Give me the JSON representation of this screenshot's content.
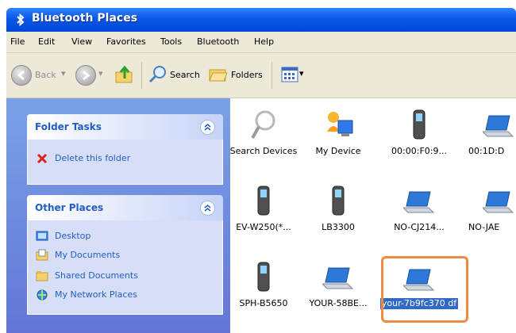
{
  "window": {
    "title": "Bluetooth Places"
  },
  "menu": [
    "File",
    "Edit",
    "View",
    "Favorites",
    "Tools",
    "Bluetooth",
    "Help"
  ],
  "toolbar": {
    "back": "Back",
    "search": "Search",
    "folders": "Folders"
  },
  "folder_tasks": {
    "title": "Folder Tasks",
    "items": [
      "Delete this folder"
    ]
  },
  "other_places": {
    "title": "Other Places",
    "items": [
      "Desktop",
      "My Documents",
      "Shared Documents",
      "My Network Places"
    ]
  },
  "devices": [
    {
      "label": "Search Devices",
      "icon": "magnifier-icon"
    },
    {
      "label": "My Device",
      "icon": "my-device-icon"
    },
    {
      "label": "00:00:F0:9...",
      "icon": "phone-icon"
    },
    {
      "label": "00:1D:D",
      "icon": "laptop-icon"
    },
    {
      "label": "EV-W250(*...",
      "icon": "phone-icon"
    },
    {
      "label": "LB3300",
      "icon": "phone-icon"
    },
    {
      "label": "NO-CJ214...",
      "icon": "laptop-icon"
    },
    {
      "label": "NO-JAE",
      "icon": "laptop-icon"
    },
    {
      "label": "SPH-B5650",
      "icon": "phone-icon"
    },
    {
      "label": "YOUR-58BE...",
      "icon": "laptop-icon"
    },
    {
      "label": "your-7b9fc370 df",
      "icon": "laptop-icon",
      "selected": true
    }
  ],
  "colors": {
    "title_bar": "#0a58e6",
    "task_pane": "#6f8ee0",
    "highlight": "#f08c42",
    "selection": "#316ac5"
  }
}
